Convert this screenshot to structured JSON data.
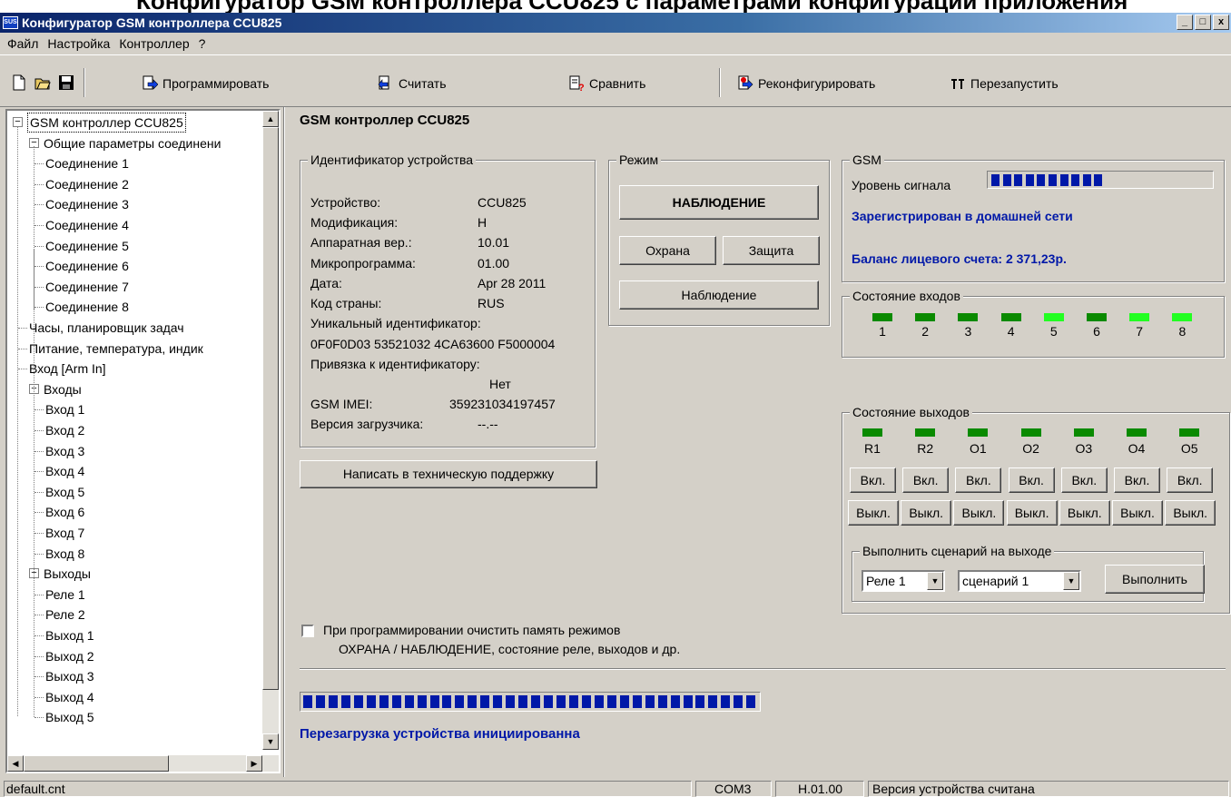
{
  "window": {
    "title": "Конфигуратор GSM контроллера CCU825",
    "app_icon": "SUS",
    "controls": [
      "_",
      "□",
      "x"
    ]
  },
  "menu": [
    "Файл",
    "Настройка",
    "Контроллер",
    "?"
  ],
  "toolbar": {
    "file_icons": [
      "new-file-icon",
      "open-folder-icon",
      "save-disk-icon"
    ],
    "buttons": {
      "program": "Программировать",
      "read": "Считать",
      "compare": "Сравнить",
      "reconfigure": "Реконфигурировать",
      "restart": "Перезапустить"
    }
  },
  "tree": {
    "root": "GSM контроллер CCU825",
    "connections_group": "Общие параметры соединени",
    "connections": [
      "Соединение 1",
      "Соединение 2",
      "Соединение 3",
      "Соединение 4",
      "Соединение 5",
      "Соединение 6",
      "Соединение 7",
      "Соединение 8"
    ],
    "clock": "Часы, планировщик задач",
    "power": "Питание, температура, индик",
    "arm_input": "Вход [Arm In]",
    "inputs_group": "Входы",
    "inputs": [
      "Вход 1",
      "Вход 2",
      "Вход 3",
      "Вход 4",
      "Вход 5",
      "Вход 6",
      "Вход 7",
      "Вход 8"
    ],
    "outputs_group": "Выходы",
    "outputs": [
      "Реле 1",
      "Реле 2",
      "Выход 1",
      "Выход 2",
      "Выход 3",
      "Выход 4",
      "Выход 5"
    ]
  },
  "main": {
    "title": "GSM контроллер CCU825",
    "device_id": {
      "legend": "Идентификатор устройства",
      "device_label": "Устройство:",
      "device_value": "CCU825",
      "mod_label": "Модификация:",
      "mod_value": "H",
      "hw_label": "Аппаратная вер.:",
      "hw_value": "10.01",
      "fw_label": "Микропрограмма:",
      "fw_value": "01.00",
      "date_label": "Дата:",
      "date_value": "Apr 28 2011",
      "country_label": "Код страны:",
      "country_value": "RUS",
      "uid_label": "Уникальный идентификатор:",
      "uid_value": "0F0F0D03 53521032 4CA63600 F5000004",
      "binding_label": "Привязка к идентификатору:",
      "binding_value": "Нет",
      "imei_label": "GSM IMEI:",
      "imei_value": "359231034197457",
      "loader_label": "Версия загрузчика:",
      "loader_value": "--.--"
    },
    "support_button": "Написать в техническую поддержку",
    "mode": {
      "legend": "Режим",
      "current": "НАБЛЮДЕНИЕ",
      "guard": "Охрана",
      "protect": "Защита",
      "observe": "Наблюдение"
    },
    "gsm": {
      "legend": "GSM",
      "signal_label": "Уровень сигнала",
      "signal_segments": 10,
      "registered": "Зарегистрирован в домашней сети",
      "balance": "Баланс лицевого счета: 2 371,23р."
    },
    "inputs_state": {
      "legend": "Состояние входов",
      "labels": [
        "1",
        "2",
        "3",
        "4",
        "5",
        "6",
        "7",
        "8"
      ],
      "colors": [
        "#0a8a00",
        "#0a8a00",
        "#0a8a00",
        "#0a8a00",
        "#22ff22",
        "#0a8a00",
        "#22ff22",
        "#22ff22"
      ]
    },
    "outputs_state": {
      "legend": "Состояние выходов",
      "labels": [
        "R1",
        "R2",
        "O1",
        "O2",
        "O3",
        "O4",
        "O5"
      ],
      "on_label": "Вкл.",
      "off_label": "Выкл.",
      "scenario": {
        "legend": "Выполнить сценарий на выходе",
        "output_value": "Реле 1",
        "scenario_value": "сценарий 1",
        "run_button": "Выполнить"
      }
    },
    "clear_memory_line1": "При программировании очистить память режимов",
    "clear_memory_line2": "ОХРАНА / НАБЛЮДЕНИЕ, состояние реле, выходов и др.",
    "progress": {
      "value": 1.0,
      "segments": 36,
      "message": "Перезагрузка устройства инициированна"
    }
  },
  "status": {
    "file": "default.cnt",
    "port": "COM3",
    "version": "H.01.00",
    "message": "Версия устройства считана"
  },
  "colors": {
    "accent_blue": "#0018a8",
    "led_on": "#22ff22",
    "led_off": "#0a8a00"
  }
}
